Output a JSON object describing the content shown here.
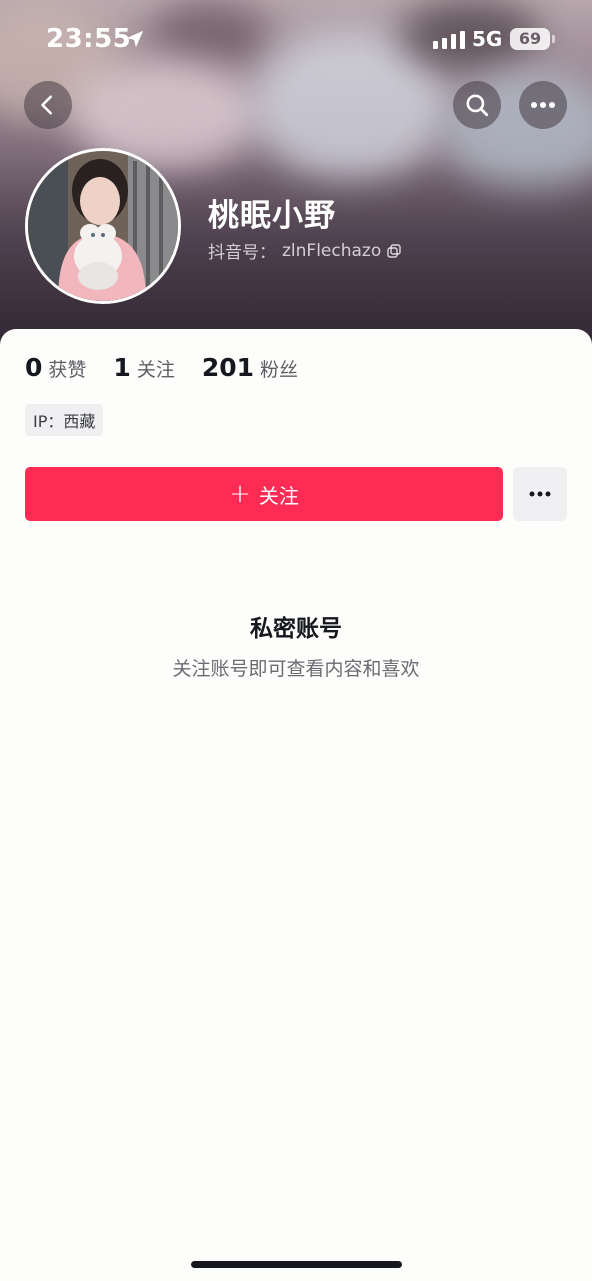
{
  "status_bar": {
    "time": "23:55",
    "network": "5G",
    "battery": "69"
  },
  "profile": {
    "name": "桃眠小野",
    "id_label": "抖音号：",
    "id_value": "zlnFlechazo"
  },
  "stats": [
    {
      "value": "0",
      "label": "获赞"
    },
    {
      "value": "1",
      "label": "关注"
    },
    {
      "value": "201",
      "label": "粉丝"
    }
  ],
  "ip_tag": "IP：西藏",
  "actions": {
    "follow_label": "关注",
    "follow_icon": "plus-icon",
    "more_icon": "ellipsis-icon"
  },
  "private_notice": {
    "title": "私密账号",
    "subtitle": "关注账号即可查看内容和喜欢"
  },
  "colors": {
    "accent": "#fe2c55",
    "text_primary": "#16181f",
    "text_secondary": "#6a6c73",
    "tag_bg": "#f0f0f2"
  }
}
